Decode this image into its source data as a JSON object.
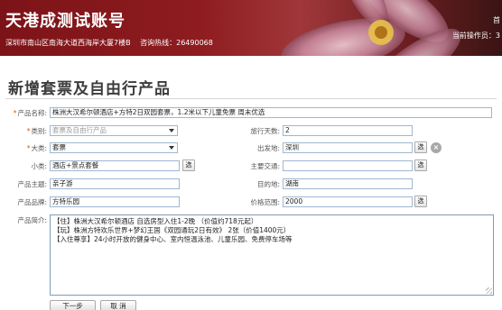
{
  "header": {
    "site_title": "天港成测试账号",
    "address": "深圳市南山区南海大道西海岸大厦7楼B",
    "hotline": "咨询热线：26490068",
    "right_top": "首",
    "right_bottom": "当前操作员：3"
  },
  "page": {
    "title": "新增套票及自由行产品"
  },
  "form": {
    "product_name": {
      "label": "产品名称:",
      "required": true,
      "value": "株洲大汉希尔顿酒店+方特2日双园套票，1.2米以下儿童免票 周末优选"
    },
    "category": {
      "label": "类别:",
      "required": true,
      "value": "套票及自由行产品"
    },
    "travel_days": {
      "label": "旅行天数:",
      "value": "2"
    },
    "major_type": {
      "label": "大类:",
      "required": true,
      "value": "套票"
    },
    "departure": {
      "label": "出发地:",
      "value": "深圳"
    },
    "minor_type": {
      "label": "小类:",
      "value": "酒店+景点套餐"
    },
    "transport": {
      "label": "主要交通:",
      "value": ""
    },
    "theme": {
      "label": "产品主题:",
      "value": "亲子游"
    },
    "destination": {
      "label": "目的地:",
      "value": "湖南"
    },
    "brand": {
      "label": "产品品牌:",
      "value": "方特乐园"
    },
    "price_range": {
      "label": "价格范围:",
      "value": "2000"
    },
    "intro": {
      "label": "产品简介:",
      "lines": [
        "【住】株洲大汉希尔顿酒店  自选房型入住1-2晚 （价值约718元起）",
        "【玩】株洲方特欢乐世界+梦幻王国《双园通玩2日有效》 2张（价值1400元）",
        "【入住尊享】24小时开放的健身中心、室内恒温泳池、儿童乐园、免费停车场等"
      ]
    },
    "pick_label": "选",
    "clear_label": "×"
  },
  "actions": {
    "next_label": "下一步",
    "cancel_label": "取 消"
  },
  "colors": {
    "banner": "#8e1c20",
    "input_border": "#9eb7d1",
    "required_star": "#e05a00"
  }
}
